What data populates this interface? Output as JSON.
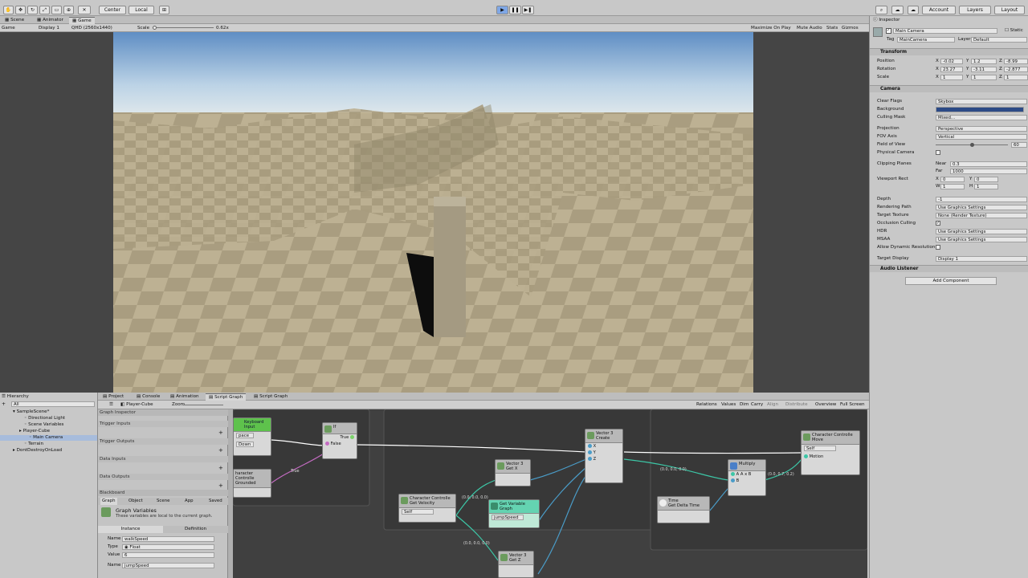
{
  "toolbar": {
    "center": "Center",
    "local": "Local",
    "account": "Account",
    "layers": "Layers",
    "layout": "Layout"
  },
  "view_tabs": [
    "Scene",
    "Animator",
    "Game"
  ],
  "game_toolbar": {
    "display_mode": "Game",
    "display": "Display 1",
    "resolution": "QHD (2560x1440)",
    "scale_label": "Scale",
    "scale_value": "0.62x",
    "maximize": "Maximize On Play",
    "mute": "Mute Audio",
    "stats": "Stats",
    "gizmos": "Gizmos"
  },
  "inspector": {
    "tab": "Inspector",
    "object_name": "Main Camera",
    "static": "Static",
    "tag_label": "Tag",
    "tag": "MainCamera",
    "layer_label": "Layer",
    "layer": "Default",
    "transform": {
      "title": "Transform",
      "position_label": "Position",
      "position": [
        "-0.02",
        "1.2",
        "-8.99"
      ],
      "rotation_label": "Rotation",
      "rotation": [
        "23.27",
        "-3.11",
        "-2.877"
      ],
      "scale_label": "Scale",
      "scale": [
        "1",
        "1",
        "1"
      ]
    },
    "camera": {
      "title": "Camera",
      "rows": [
        {
          "label": "Clear Flags",
          "value": "Skybox"
        },
        {
          "label": "Background",
          "value": ""
        },
        {
          "label": "Culling Mask",
          "value": "Mixed..."
        },
        {
          "label": "Projection",
          "value": "Perspective"
        },
        {
          "label": "FOV Axis",
          "value": "Vertical"
        },
        {
          "label": "Field of View",
          "value": "60"
        },
        {
          "label": "Physical Camera",
          "value": ""
        },
        {
          "label": "Clipping Planes",
          "value": ""
        },
        {
          "label": "Viewport Rect",
          "value": ""
        },
        {
          "label": "Depth",
          "value": "-1"
        },
        {
          "label": "Rendering Path",
          "value": "Use Graphics Settings"
        },
        {
          "label": "Target Texture",
          "value": "None (Render Texture)"
        },
        {
          "label": "Occlusion Culling",
          "value": ""
        },
        {
          "label": "HDR",
          "value": "Use Graphics Settings"
        },
        {
          "label": "MSAA",
          "value": "Use Graphics Settings"
        },
        {
          "label": "Allow Dynamic Resolution",
          "value": ""
        },
        {
          "label": "Target Display",
          "value": "Display 1"
        }
      ],
      "near_label": "Near",
      "near": "0.3",
      "far_label": "Far",
      "far": "1000",
      "vp_x": "0",
      "vp_y": "0",
      "vp_w": "1",
      "vp_h": "1",
      "background_color": "#2c4a86",
      "fov_fraction": 0.5
    },
    "audio": "Audio Listener",
    "add_component": "Add Component"
  },
  "hierarchy": {
    "title": "Hierarchy",
    "search": "All",
    "items": [
      "SampleScene*",
      "Directional Light",
      "Scene Variables",
      "Player-Cube",
      "Main Camera",
      "Terrain",
      "DontDestroyOnLoad"
    ]
  },
  "bottom_tabs": [
    "Project",
    "Console",
    "Animation",
    "Script Graph",
    "Script Graph"
  ],
  "sg_toolbar": {
    "breadcrumb": "Player-Cube",
    "zoom": "Zoom",
    "relations": "Relations",
    "values": "Values",
    "dim": "Dim",
    "carry": "Carry",
    "align": "Align",
    "distribute": "Distribute",
    "overview": "Overview",
    "fullscreen": "Full Screen"
  },
  "graph_inspector": {
    "title": "Graph Inspector",
    "trigger_inputs": "Trigger Inputs",
    "trigger_outputs": "Trigger Outputs",
    "data_inputs": "Data Inputs",
    "data_outputs": "Data Outputs",
    "blackboard": "Blackboard",
    "bb_tabs": [
      "Graph",
      "Object",
      "Scene",
      "App",
      "Saved"
    ],
    "vars_title": "Graph Variables",
    "vars_desc": "These variables are local to the current graph.",
    "instance": "Instance",
    "definition": "Definition",
    "var1": {
      "name_label": "Name",
      "name": "walkSpeed",
      "type_label": "Type",
      "type": "Float",
      "value_label": "Value",
      "value": "6"
    },
    "var2": {
      "name_label": "Name",
      "name": "jumpSpeed"
    }
  },
  "nodes": {
    "keyboard": {
      "title": "Keyboard Input",
      "field1": "pace",
      "field2": "Down"
    },
    "if": {
      "title": "If",
      "true": "True",
      "false": "False"
    },
    "grounded": {
      "title": "haracter Controlle",
      "sub": "Grounded"
    },
    "getvel": {
      "title": "Character Controlle",
      "sub": "Get Velocity",
      "self": "Self"
    },
    "getx": {
      "title": "Vector 3",
      "sub": "Get X"
    },
    "getvar": {
      "title": "Get Variable",
      "kind": "Graph",
      "var": "jumpSpeed"
    },
    "getz": {
      "title": "Vector 3",
      "sub": "Get Z"
    },
    "create": {
      "title": "Vector 3",
      "sub": "Create",
      "x": "X",
      "y": "Y",
      "z": "Z"
    },
    "multiply": {
      "title": "Multiply",
      "a": "A",
      "b": "B",
      "op": "A x B"
    },
    "time": {
      "title": "Time",
      "sub": "Get Delta Time"
    },
    "move": {
      "title": "Character Controlle",
      "sub": "Move",
      "self": "Self",
      "motion": "Motion"
    },
    "labels": {
      "l1": "(0.0, 0.0, 0.0)",
      "l2": "(0.0, 0.0, 0.0)",
      "l3": "(0.0, 0.0, 0.0)",
      "l4": "(0.0, 0.7, 0.2)",
      "l5": "True"
    }
  }
}
